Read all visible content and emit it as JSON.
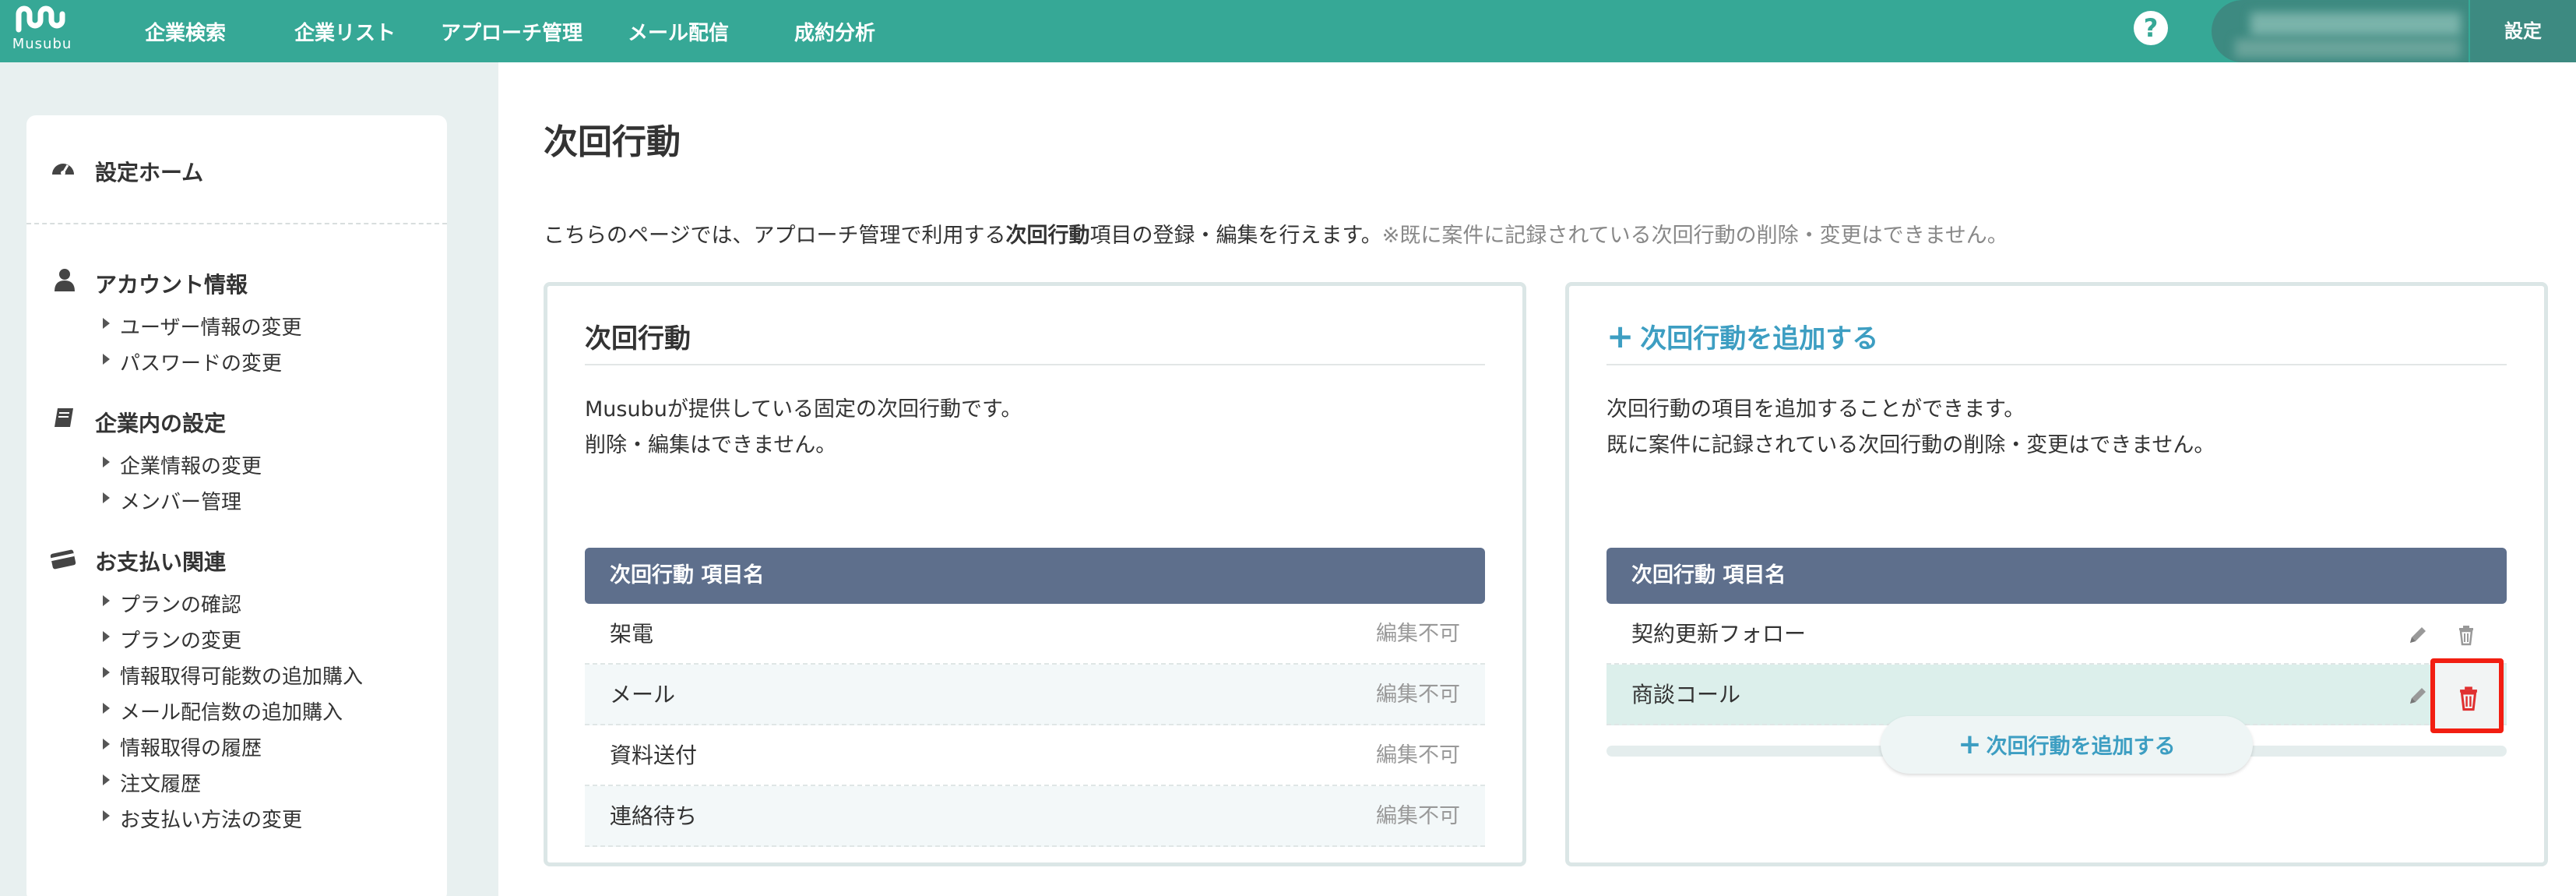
{
  "header": {
    "logo_text": "Musubu",
    "nav": [
      "企業検索",
      "企業リスト",
      "アプローチ管理",
      "メール配信",
      "成約分析"
    ],
    "help": "?",
    "settings": "設定"
  },
  "sidebar": {
    "home": "設定ホーム",
    "groups": [
      {
        "label": "アカウント情報",
        "items": [
          "ユーザー情報の変更",
          "パスワードの変更"
        ]
      },
      {
        "label": "企業内の設定",
        "items": [
          "企業情報の変更",
          "メンバー管理"
        ]
      },
      {
        "label": "お支払い関連",
        "items": [
          "プランの確認",
          "プランの変更",
          "情報取得可能数の追加購入",
          "メール配信数の追加購入",
          "情報取得の履歴",
          "注文履歴",
          "お支払い方法の変更"
        ]
      }
    ]
  },
  "main": {
    "title": "次回行動",
    "desc_pre": "こちらのページでは、アプローチ管理で利用する",
    "desc_bold": "次回行動",
    "desc_post": "項目の登録・編集を行えます。",
    "desc_note": "※既に案件に記録されている次回行動の削除・変更はできません。"
  },
  "fixed_panel": {
    "title": "次回行動",
    "desc1": "Musubuが提供している固定の次回行動です。",
    "desc2": "削除・編集はできません。",
    "header": "次回行動 項目名",
    "rows": [
      {
        "name": "架電",
        "status": "編集不可"
      },
      {
        "name": "メール",
        "status": "編集不可"
      },
      {
        "name": "資料送付",
        "status": "編集不可"
      },
      {
        "name": "連絡待ち",
        "status": "編集不可"
      }
    ]
  },
  "custom_panel": {
    "plus": "+",
    "title": "次回行動を追加する",
    "desc1": "次回行動の項目を追加することができます。",
    "desc2": "既に案件に記録されている次回行動の削除・変更はできません。",
    "header": "次回行動 項目名",
    "rows": [
      {
        "name": "契約更新フォロー"
      },
      {
        "name": "商談コール"
      }
    ],
    "add_button": "次回行動を追加する"
  },
  "colors": {
    "brand": "#36a896",
    "table_header": "#5e6f8c",
    "accent": "#3d9ec2",
    "highlight_row": "#dcefeb",
    "focus_box": "#f21e11"
  }
}
